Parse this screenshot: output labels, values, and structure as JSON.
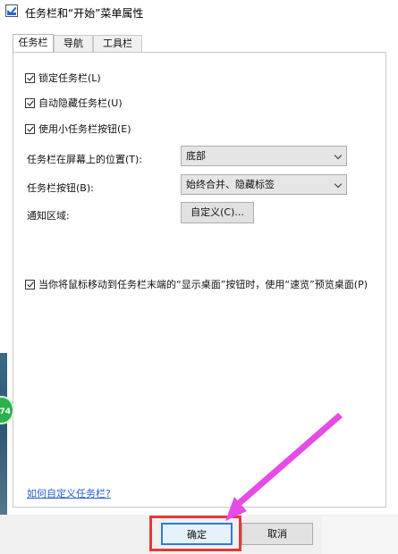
{
  "window": {
    "title": "任务栏和“开始”菜单属性"
  },
  "tabs": [
    {
      "label": "任务栏",
      "active": true
    },
    {
      "label": "导航",
      "active": false
    },
    {
      "label": "工具栏",
      "active": false
    }
  ],
  "options": {
    "lock_taskbar": {
      "label": "锁定任务栏(L)",
      "checked": true
    },
    "auto_hide": {
      "label": "自动隐藏任务栏(U)",
      "checked": true
    },
    "small_buttons": {
      "label": "使用小任务栏按钮(E)",
      "checked": true
    },
    "peek": {
      "label": "当你将鼠标移动到任务栏末端的“显示桌面”按钮时，使用“速览”预览桌面(P)",
      "checked": true
    }
  },
  "settings": {
    "location": {
      "label": "任务栏在屏幕上的位置(T):",
      "value": "底部"
    },
    "buttons": {
      "label": "任务栏按钮(B):",
      "value": "始终合并、隐藏标签"
    },
    "notification": {
      "label": "通知区域:",
      "button": "自定义(C)..."
    }
  },
  "help_link": "如何自定义任务栏?",
  "footer": {
    "ok": "确定",
    "cancel": "取消"
  },
  "side_badge": "74",
  "colors": {
    "highlight": "#e53935",
    "arrow": "#e64be6",
    "link": "#2a62c9"
  }
}
